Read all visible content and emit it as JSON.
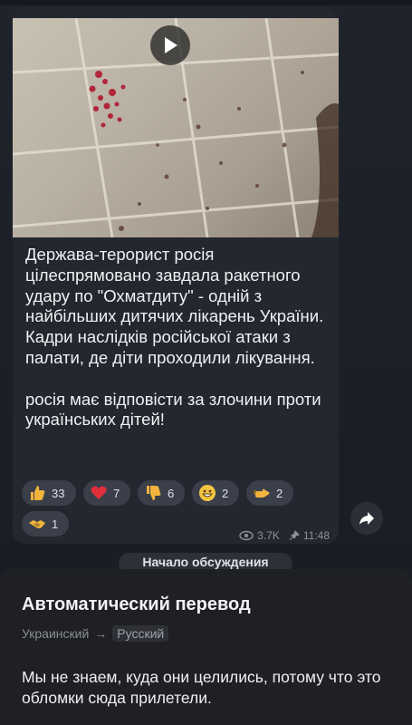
{
  "post": {
    "text": "Держава-терорист росія цілеспрямовано завдала ракетного удару по \"Охматдиту\" - одній з найбільших дитячих лікарень України. Кадри наслідків російської атаки з палати, де діти проходили лікування.\n\nросія має відповісти за злочини проти українських дітей!",
    "views": "3.7K",
    "time": "11:48",
    "media": {
      "type": "video",
      "play_icon": "play-icon"
    },
    "reactions": [
      {
        "emoji": "thumbs-up",
        "count": "33"
      },
      {
        "emoji": "red-heart",
        "count": "7"
      },
      {
        "emoji": "thumbs-down",
        "count": "6"
      },
      {
        "emoji": "grinning-face",
        "count": "2"
      },
      {
        "emoji": "pointing-hand",
        "count": "2"
      },
      {
        "emoji": "handshake",
        "count": "1"
      }
    ]
  },
  "discussion_label": "Начало обсуждения",
  "translation_sheet": {
    "title": "Автоматический перевод",
    "source_lang": "Украинский",
    "arrow": "→",
    "target_lang": "Русский",
    "translated_text": "Мы не знаем, куда они целились, потому что это обломки сюда прилетели."
  },
  "colors": {
    "background": "#1b1f27",
    "bubble": "#23272f",
    "reaction_pill": "#3a3f4a",
    "sheet": "#1f2024"
  }
}
